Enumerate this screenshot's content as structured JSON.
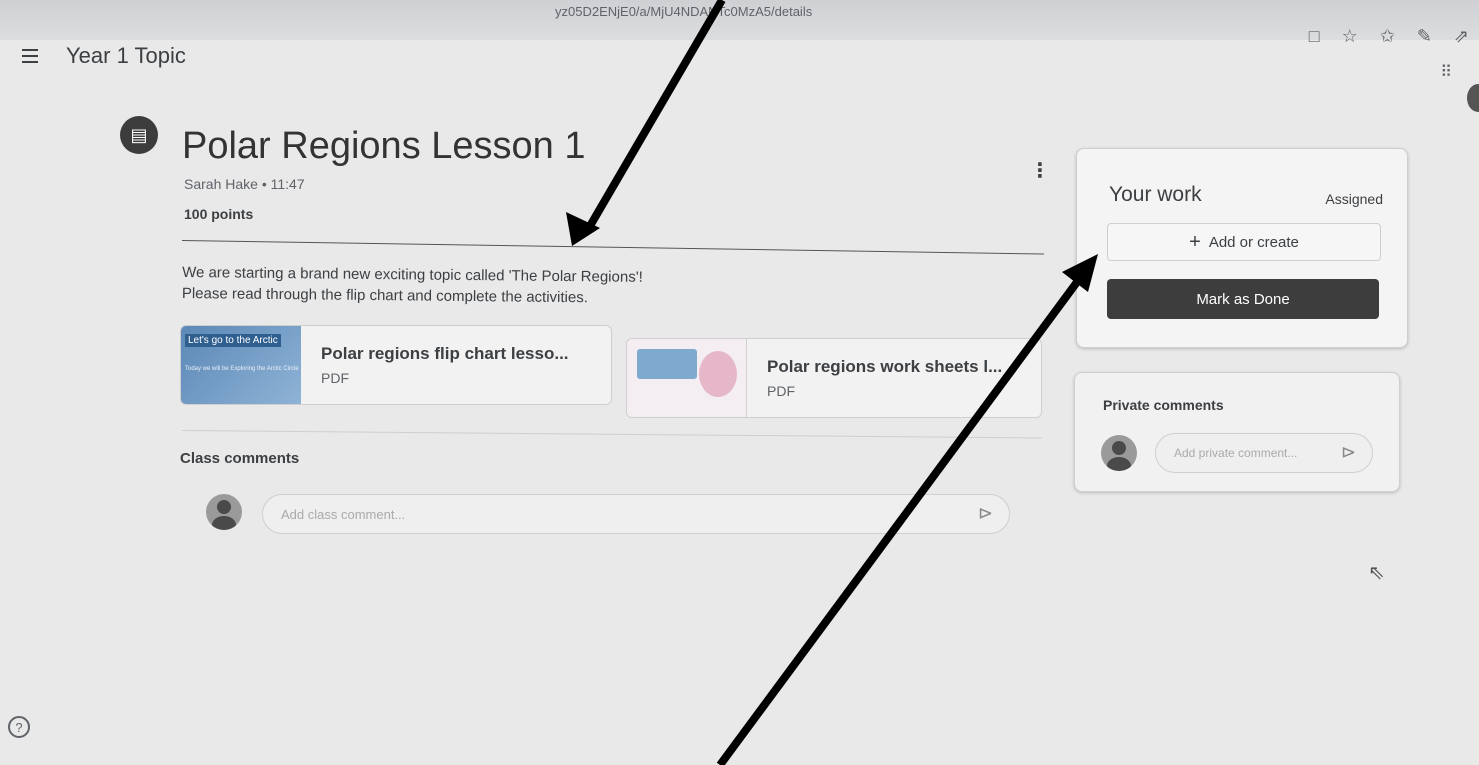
{
  "browser": {
    "url": "yz05D2ENjE0/a/MjU4NDANTc0MzA5/details",
    "toolbar_icons": [
      "□",
      "☆",
      "✩",
      "✎",
      "⇗"
    ]
  },
  "header": {
    "class_title": "Year 1 Topic",
    "apps_icon": "⠿"
  },
  "assignment": {
    "icon": "▤",
    "title": "Polar Regions Lesson 1",
    "meta": "Sarah Hake • 11:47",
    "points": "100 points",
    "kebab": "⋮",
    "description_line1": "We are starting a brand new exciting topic called 'The Polar Regions'!",
    "description_line2": "Please read through the flip chart and complete the activities.",
    "attachments": [
      {
        "name": "Polar regions flip chart lesso...",
        "type": "PDF",
        "thumb_title": "Let's go to the Arctic",
        "thumb_sub": "Today we will be Exploring the Arctic Circle"
      },
      {
        "name": "Polar regions work sheets l...",
        "type": "PDF"
      }
    ]
  },
  "class_comments": {
    "label": "Class comments",
    "placeholder": "Add class comment..."
  },
  "your_work": {
    "title": "Your work",
    "status": "Assigned",
    "add_label": "Add or create",
    "done_label": "Mark as Done"
  },
  "private_comments": {
    "label": "Private comments",
    "placeholder": "Add private comment..."
  },
  "help_icon": "?",
  "send_icon": "⊳"
}
